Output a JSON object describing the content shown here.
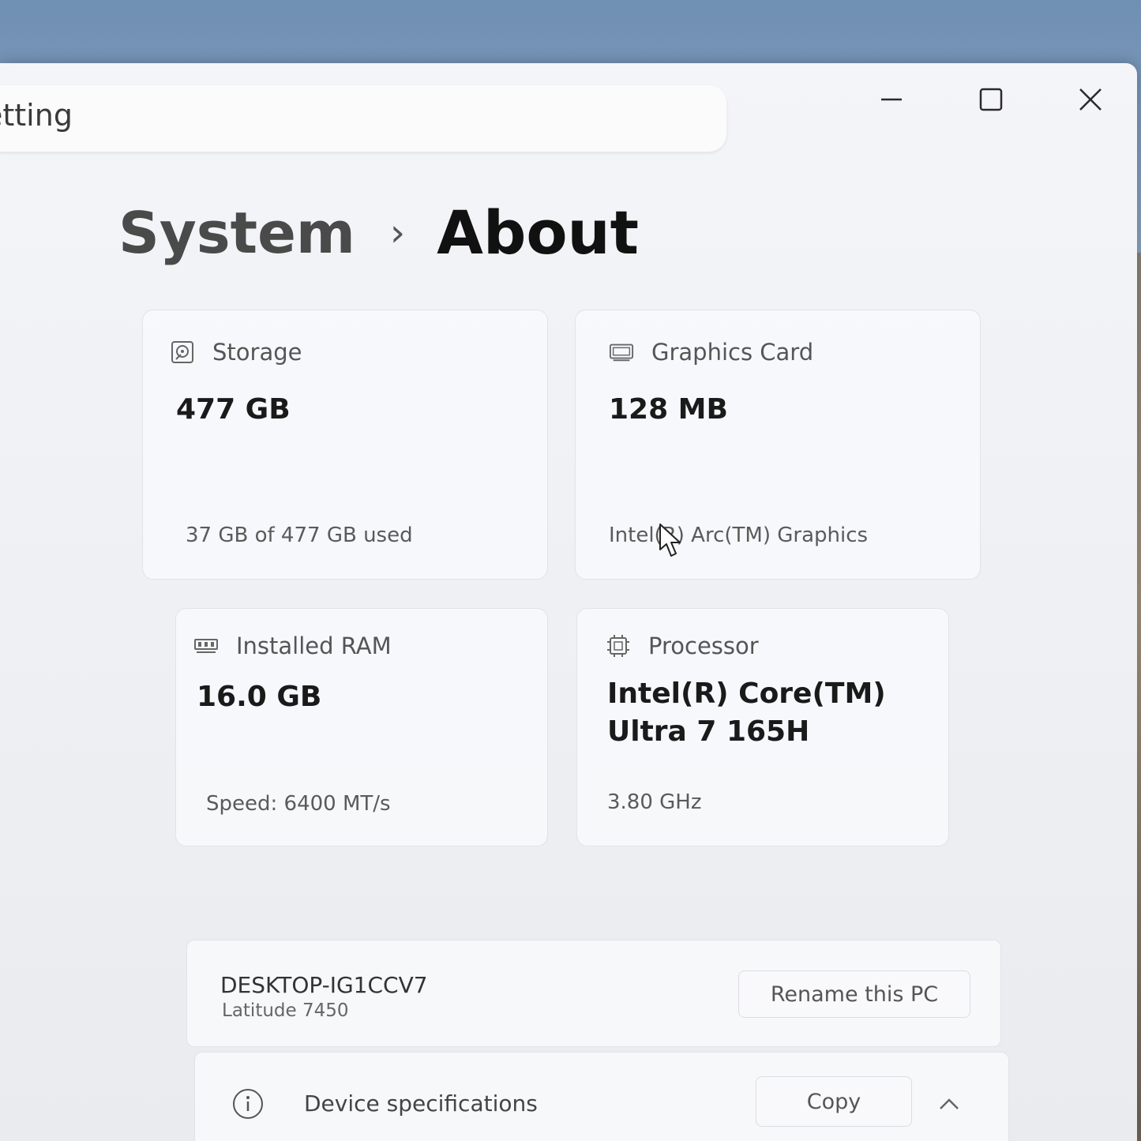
{
  "search": {
    "text": "etting"
  },
  "window_controls": {
    "minimize": "minimize-icon",
    "maximize": "maximize-icon",
    "close": "close-icon"
  },
  "breadcrumb": {
    "parent": "System",
    "separator": "›",
    "current": "About"
  },
  "cards": {
    "storage": {
      "label": "Storage",
      "value": "477 GB",
      "detail": "37 GB of 477 GB used",
      "icon": "storage-icon"
    },
    "graphics": {
      "label": "Graphics Card",
      "value": "128 MB",
      "detail": "Intel(R) Arc(TM) Graphics",
      "icon": "graphics-card-icon"
    },
    "ram": {
      "label": "Installed RAM",
      "value": "16.0 GB",
      "detail": "Speed: 6400 MT/s",
      "icon": "ram-icon"
    },
    "processor": {
      "label": "Processor",
      "value_line1": "Intel(R) Core(TM)",
      "value_line2": "Ultra 7 165H",
      "detail": "3.80 GHz",
      "icon": "processor-icon"
    }
  },
  "pc": {
    "name": "DESKTOP-IG1CCV7",
    "model": "Latitude 7450",
    "rename_label": "Rename this PC"
  },
  "device_specs": {
    "label": "Device specifications",
    "copy_label": "Copy",
    "icon": "info-icon",
    "chevron": "chevron-up-icon"
  }
}
